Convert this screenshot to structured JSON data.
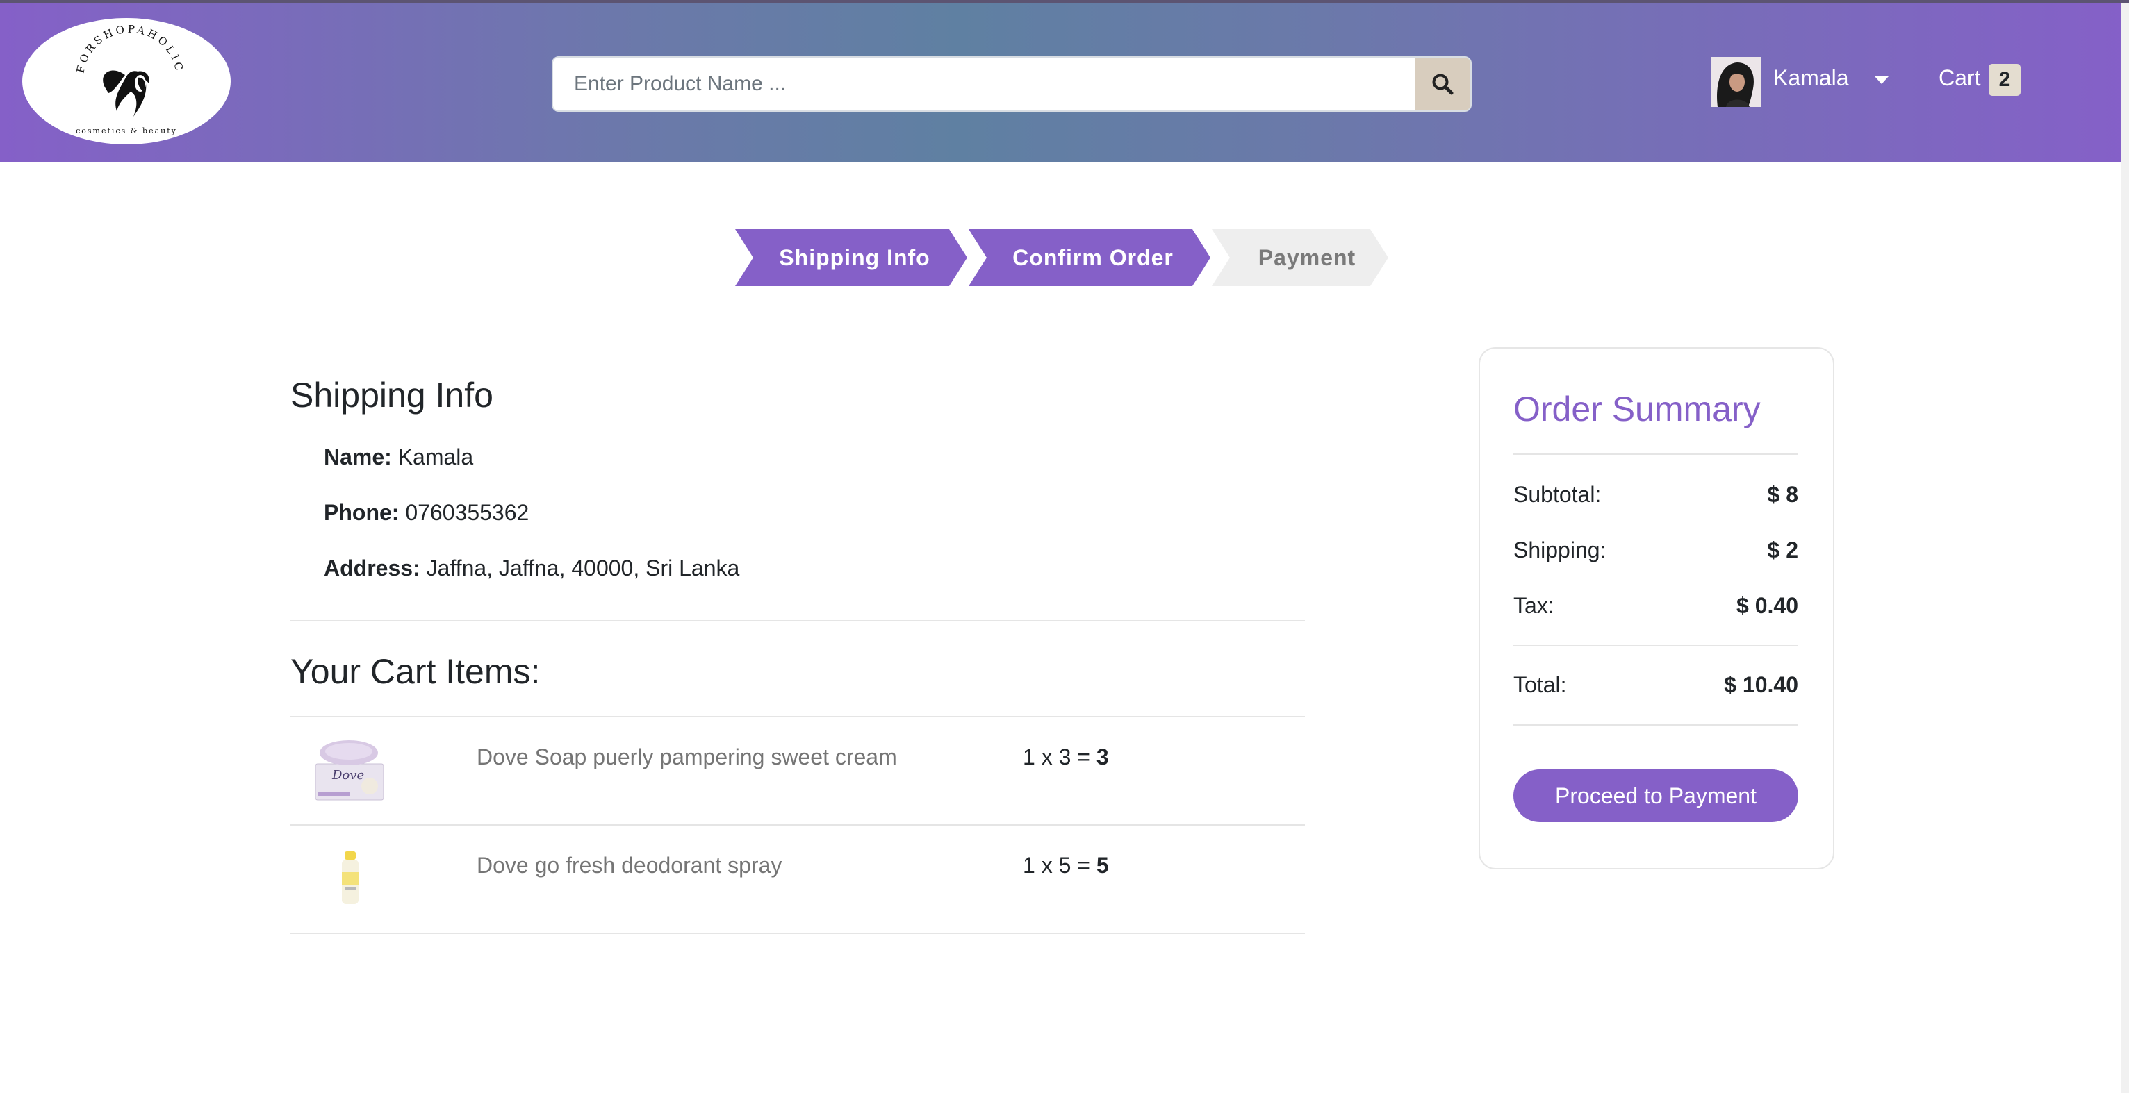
{
  "brand": {
    "name": "FORSHOPAHOLIC",
    "tagline": "cosmetics & beauty"
  },
  "header": {
    "search_placeholder": "Enter Product Name ...",
    "user_name": "Kamala",
    "cart_label": "Cart",
    "cart_count": "2"
  },
  "steps": [
    {
      "label": "Shipping Info",
      "state": "active"
    },
    {
      "label": "Confirm Order",
      "state": "active"
    },
    {
      "label": "Payment",
      "state": "inactive"
    }
  ],
  "shipping": {
    "title": "Shipping Info",
    "name_label": "Name:",
    "name_value": " Kamala",
    "phone_label": "Phone:",
    "phone_value": " 0760355362",
    "address_label": "Address:",
    "address_value": " Jaffna, Jaffna, 40000, Sri Lanka"
  },
  "cart": {
    "title": "Your Cart Items:",
    "items": [
      {
        "name": "Dove Soap puerly pampering sweet cream",
        "qty_price": "1 x 3 = ",
        "total": "3"
      },
      {
        "name": "Dove go fresh deodorant spray",
        "qty_price": "1 x 5 = ",
        "total": "5"
      }
    ]
  },
  "summary": {
    "title": "Order Summary",
    "subtotal_label": "Subtotal:",
    "subtotal_value": "$ 8",
    "shipping_label": "Shipping:",
    "shipping_value": "$ 2",
    "tax_label": "Tax:",
    "tax_value": "$ 0.40",
    "total_label": "Total:",
    "total_value": "$ 10.40",
    "proceed_label": "Proceed to Payment"
  },
  "colors": {
    "accent": "#8560c8",
    "header_gradient_mid": "#5f80a2",
    "step_inactive": "#eeeeee"
  }
}
